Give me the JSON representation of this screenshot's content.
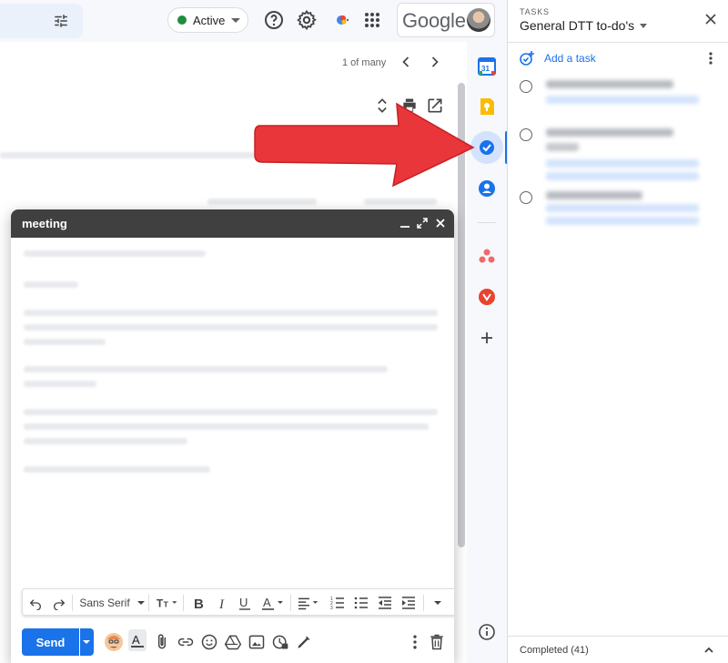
{
  "topbar": {
    "status": {
      "label": "Active",
      "color": "#1e8e3e"
    },
    "logo": "Google",
    "icons": [
      "tune-icon",
      "help-icon",
      "settings-icon",
      "gemini-icon",
      "apps-grid-icon"
    ]
  },
  "mail": {
    "pager": "1 of many",
    "tools": [
      "expand-collapse-icon",
      "print-icon",
      "open-new-window-icon"
    ]
  },
  "compose": {
    "title": "meeting",
    "controls": [
      "minimize-icon",
      "fullscreen-icon",
      "close-icon"
    ],
    "format_toolbar": {
      "font": "Sans Serif",
      "items": [
        "undo-icon",
        "redo-icon",
        "font-size-icon",
        "bold-icon",
        "italic-icon",
        "underline-icon",
        "text-color-icon",
        "align-icon",
        "numbered-list-icon",
        "bulleted-list-icon",
        "indent-less-icon",
        "indent-more-icon",
        "more-formatting-icon"
      ]
    },
    "send_label": "Send",
    "bottom_icons": [
      "avatar-icon",
      "formatting-icon",
      "attach-icon",
      "link-icon",
      "emoji-icon",
      "drive-icon",
      "photo-icon",
      "confidential-icon",
      "signature-icon",
      "more-options-icon",
      "discard-icon"
    ]
  },
  "side_rail": {
    "apps": [
      "calendar-icon",
      "keep-icon",
      "tasks-icon",
      "contacts-icon",
      "asana-icon",
      "gifcandy-icon",
      "add-app-icon",
      "info-icon"
    ],
    "selected": "tasks-icon",
    "calendar_day": "31"
  },
  "tasks": {
    "label": "TASKS",
    "list_name": "General DTT to-do's",
    "add_task": "Add a task",
    "completed": "Completed (41)"
  },
  "colors": {
    "accent": "#1a73e8",
    "arrow": "#e8363a",
    "compose_header": "#404040"
  }
}
